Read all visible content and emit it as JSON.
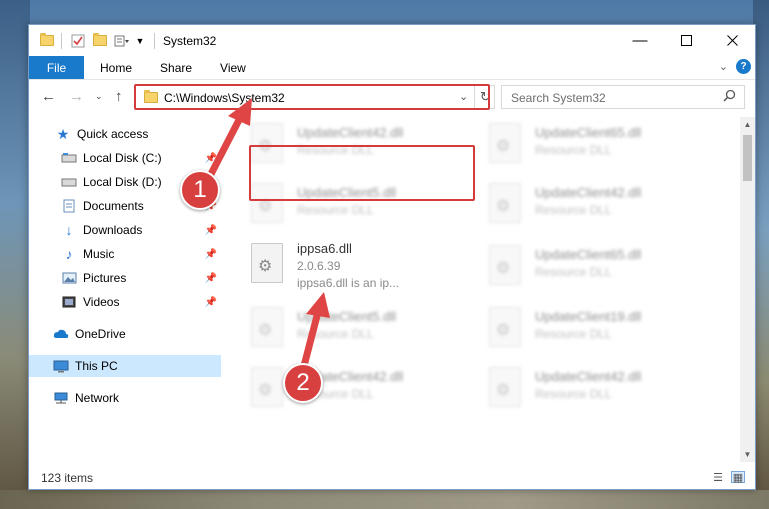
{
  "window": {
    "title": "System32"
  },
  "ribbon": {
    "tabs": [
      "File",
      "Home",
      "Share",
      "View"
    ],
    "help_label": "?"
  },
  "address": {
    "path": "C:\\Windows\\System32",
    "search_placeholder": "Search System32"
  },
  "sidebar": {
    "items": [
      {
        "label": "Quick access",
        "icon": "star-icon",
        "pinned": false
      },
      {
        "label": "Local Disk (C:)",
        "icon": "drive-icon",
        "pinned": true
      },
      {
        "label": "Local Disk (D:)",
        "icon": "drive-icon",
        "pinned": true
      },
      {
        "label": "Documents",
        "icon": "documents-icon",
        "pinned": true
      },
      {
        "label": "Downloads",
        "icon": "download-icon",
        "pinned": true
      },
      {
        "label": "Music",
        "icon": "music-icon",
        "pinned": true
      },
      {
        "label": "Pictures",
        "icon": "pictures-icon",
        "pinned": true
      },
      {
        "label": "Videos",
        "icon": "videos-icon",
        "pinned": true
      },
      {
        "label": "OneDrive",
        "icon": "cloud-icon",
        "pinned": false
      },
      {
        "label": "This PC",
        "icon": "computer-icon",
        "pinned": false
      },
      {
        "label": "Network",
        "icon": "network-icon",
        "pinned": false
      }
    ]
  },
  "files": {
    "col1": [
      {
        "name": "UpdateClient42.dll",
        "sub": "Resource DLL"
      },
      {
        "name": "UpdateClient5.dll",
        "sub": "Resource DLL"
      },
      {
        "name": "ippsa6.dll",
        "sub": "2.0.6.39",
        "sub2": "ippsa6.dll is an ip..."
      },
      {
        "name": "UpdateClient5.dll",
        "sub": "Resource DLL"
      },
      {
        "name": "UpdateClient42.dll",
        "sub": "Resource DLL"
      }
    ],
    "col2": [
      {
        "name": "UpdateClient65.dll",
        "sub": "Resource DLL"
      },
      {
        "name": "UpdateClient42.dll",
        "sub": "Resource DLL"
      },
      {
        "name": "UpdateClient65.dll",
        "sub": "Resource DLL"
      },
      {
        "name": "UpdateClient19.dll",
        "sub": "Resource DLL"
      },
      {
        "name": "UpdateClient42.dll",
        "sub": "Resource DLL"
      }
    ]
  },
  "status": {
    "item_count": "123 items"
  },
  "annotations": {
    "badge1": "1",
    "badge2": "2"
  },
  "colors": {
    "accent": "#1979ca",
    "highlight": "#d63b3b",
    "selection": "#cce8ff"
  }
}
